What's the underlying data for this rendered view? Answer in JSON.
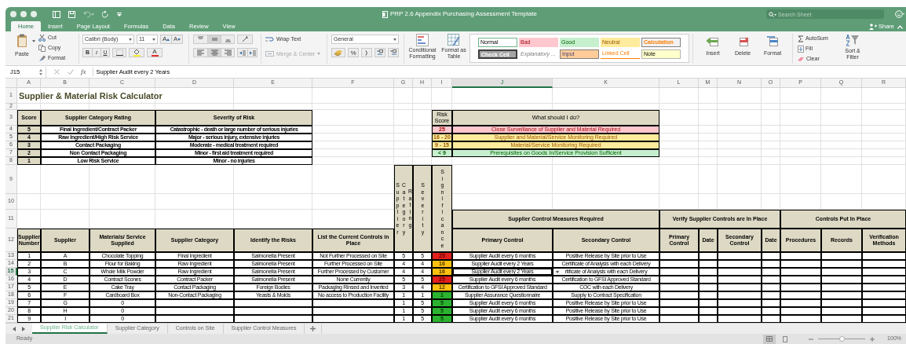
{
  "window": {
    "title": "PRP 2.6 Appendix Purchasing Assessment Template",
    "search_placeholder": "Search Sheet"
  },
  "ribbon_tabs": [
    {
      "label": "Home",
      "selected": true
    },
    {
      "label": "Insert",
      "selected": false
    },
    {
      "label": "Page Layout",
      "selected": false
    },
    {
      "label": "Formulas",
      "selected": false
    },
    {
      "label": "Data",
      "selected": false
    },
    {
      "label": "Review",
      "selected": false
    },
    {
      "label": "View",
      "selected": false
    }
  ],
  "share": "Share",
  "ribbon": {
    "paste": "Paste",
    "cut": "Cut",
    "copy": "Copy",
    "format_painter": "Format",
    "font": "Calibri (Body)",
    "size": "11",
    "grow": "A",
    "shrink": "A",
    "bold": "B",
    "italic": "I",
    "underline": "U",
    "font_color": "A",
    "vertical_align": [
      {
        "selected": false
      },
      {
        "selected": true
      },
      {
        "selected": false
      }
    ],
    "horizontal_align": [
      {
        "selected": false
      },
      {
        "selected": true
      },
      {
        "selected": false
      }
    ],
    "wrap": "Wrap Text",
    "merge": {
      "label": "Merge & Center",
      "disabled": true
    },
    "number_format": "General",
    "percent": "%",
    "conditional": "Conditional Formatting",
    "format_table": "Format as Table",
    "cell_styles": [
      {
        "label": "Normal",
        "kind": "normal"
      },
      {
        "label": "Bad",
        "kind": "bad"
      },
      {
        "label": "Good",
        "kind": "good"
      },
      {
        "label": "Neutral",
        "kind": "neutral"
      },
      {
        "label": "Calculation",
        "kind": "calculation"
      },
      {
        "label": "Check Cell",
        "kind": "check"
      },
      {
        "label": "Explanatory ...",
        "kind": "explanatory"
      },
      {
        "label": "Input",
        "kind": "input"
      },
      {
        "label": "Linked Cell",
        "kind": "linked"
      },
      {
        "label": "Note",
        "kind": "note"
      }
    ],
    "cells": [
      "Insert",
      "Delete",
      "Format"
    ],
    "autosum": "AutoSum",
    "fill": "Fill",
    "clear": "Clear",
    "sort": "Sort & Filter"
  },
  "formula_bar": {
    "cell": "J15",
    "function_label": "fx",
    "value": "Supplier Audit every 2 Years"
  },
  "columns": [
    {
      "label": "A",
      "selected": false
    },
    {
      "label": "B",
      "selected": false
    },
    {
      "label": "C",
      "selected": false
    },
    {
      "label": "D",
      "selected": false
    },
    {
      "label": "E",
      "selected": false
    },
    {
      "label": "F",
      "selected": false
    },
    {
      "label": "G",
      "selected": false
    },
    {
      "label": "H",
      "selected": false
    },
    {
      "label": "I",
      "selected": false
    },
    {
      "label": "J",
      "selected": true
    },
    {
      "label": "K",
      "selected": false
    },
    {
      "label": "L",
      "selected": false
    },
    {
      "label": "M",
      "selected": false
    },
    {
      "label": "N",
      "selected": false
    },
    {
      "label": "O",
      "selected": false
    },
    {
      "label": "P",
      "selected": false
    },
    {
      "label": "Q",
      "selected": false
    },
    {
      "label": "R",
      "selected": false
    }
  ],
  "row_numbers": [
    {
      "label": "1",
      "selected": false
    },
    {
      "label": "2",
      "selected": false
    },
    {
      "label": "3",
      "selected": false
    },
    {
      "label": "4",
      "selected": false
    },
    {
      "label": "5",
      "selected": false
    },
    {
      "label": "6",
      "selected": false
    },
    {
      "label": "7",
      "selected": false
    },
    {
      "label": "8",
      "selected": false
    },
    {
      "label": "9",
      "selected": false
    },
    {
      "label": "10",
      "selected": false
    },
    {
      "label": "11",
      "selected": false
    },
    {
      "label": "12",
      "selected": false
    },
    {
      "label": "13",
      "selected": false
    },
    {
      "label": "14",
      "selected": false
    },
    {
      "label": "15",
      "selected": true
    },
    {
      "label": "16",
      "selected": false
    },
    {
      "label": "17",
      "selected": false
    },
    {
      "label": "18",
      "selected": false
    },
    {
      "label": "19",
      "selected": false
    },
    {
      "label": "20",
      "selected": false
    },
    {
      "label": "21",
      "selected": false
    }
  ],
  "title": "Supplier & Material Risk Calculator",
  "score_table": {
    "headers": [
      "Score",
      "Supplier Category Rating",
      "Severity of Risk"
    ],
    "rows": [
      {
        "score": "5",
        "category": "Final Ingredient/Contract Packer",
        "severity": "Catastrophic - death or large number of serious injuries"
      },
      {
        "score": "4",
        "category": "Raw Ingredient/High Risk Service",
        "severity": "Major - serious injury, extensive injuries"
      },
      {
        "score": "3",
        "category": "Contact Packaging",
        "severity": "Moderate - medical treatment required"
      },
      {
        "score": "2",
        "category": "Non Contact Packaging",
        "severity": "Minor - first aid treatment required"
      },
      {
        "score": "1",
        "category": "Low Risk Service",
        "severity": "Minor - no injuries"
      }
    ]
  },
  "risk_key": {
    "headers": [
      "Risk Score",
      "What should I do?"
    ],
    "rows": [
      {
        "score": "25",
        "action": "Close Surveillance of Supplier and Material Required",
        "color": "#ffc7ce"
      },
      {
        "score": "16 - 20",
        "action": "Supplier and Material/Service Monitoring Required",
        "color": "#ffeb9c"
      },
      {
        "score": "9 - 15",
        "action": "Material/Service Monitoring Required",
        "color": "#ffeb9c"
      },
      {
        "score": "< 9",
        "action": "Prerequisites on Goods In/Service Provision Sufficient",
        "color": "#c6efce"
      }
    ]
  },
  "vertical_headers": [
    "Supplier Category Rating",
    "Severity",
    "Significance"
  ],
  "group_headers": [
    "Supplier Control Measures Required",
    "Verify Supplier Controls are In Place",
    "Controls Put In Place"
  ],
  "main_headers": [
    "Supplier Number",
    "Supplier",
    "Materials/ Service Supplied",
    "Supplier Category",
    "Identify the Risks",
    "List the Current Controls in Place",
    "Primary Control",
    "Secondary Control",
    "Primary Control",
    "Date",
    "Secondary Control",
    "Date",
    "Procedures",
    "Records",
    "Verification Methods"
  ],
  "suppliers": [
    {
      "number": "1",
      "supplier": "A",
      "material": "Chocolate Topping",
      "category": "Final Ingredient",
      "risks": "Salmonella Present",
      "controls": "Not Further Processed on Site",
      "rating": "5",
      "severity": "5",
      "significance": "25",
      "color": "#e2201c",
      "primary": "Supplier Audit every 6 months",
      "secondary": "Positive Release by Site prior to Use"
    },
    {
      "number": "2",
      "supplier": "B",
      "material": "Flour for Baking",
      "category": "Raw Ingredient",
      "risks": "Salmonella Present",
      "controls": "Further Processed on Site",
      "rating": "4",
      "severity": "4",
      "significance": "16",
      "color": "#fdc10f",
      "primary": "Supplier Audit every 2 Years",
      "secondary": "Certificate of Analysis with each Delivery"
    },
    {
      "number": "3",
      "supplier": "C",
      "material": "Whole Milk Powder",
      "category": "Raw Ingredient",
      "risks": "Salmonella Present",
      "controls": "Further Processed by Customer",
      "rating": "4",
      "severity": "4",
      "significance": "16",
      "color": "#fdc10f",
      "primary": "Supplier Audit every 2 Years",
      "secondary": "rtificate of Analysis with each Delivery"
    },
    {
      "number": "4",
      "supplier": "D",
      "material": "Contract Scones",
      "category": "Contract Packer",
      "risks": "Salmonella Present",
      "controls": "None Currently",
      "rating": "5",
      "severity": "5",
      "significance": "25",
      "color": "#e2201c",
      "primary": "Supplier Audit every 6 months",
      "secondary": "Certification to GFSI Approved Standard"
    },
    {
      "number": "5",
      "supplier": "E",
      "material": "Cake Tray",
      "category": "Contact Packaging",
      "risks": "Foreign Bodies",
      "controls": "Packaging Rinsed and Inverted",
      "rating": "3",
      "severity": "4",
      "significance": "12",
      "color": "#fdc10f",
      "primary": "Certification to GFSI Approved Standard",
      "secondary": "COC with each Delivery"
    },
    {
      "number": "6",
      "supplier": "F",
      "material": "Cardboard Box",
      "category": "Non-Contact Packaging",
      "risks": "Yeasts & Molds",
      "controls": "No access to Production Facility",
      "rating": "1",
      "severity": "1",
      "significance": "1",
      "color": "#2bb230",
      "primary": "Supplier Assurance Questionnaire",
      "secondary": "Supply to Contract Specification"
    },
    {
      "number": "7",
      "supplier": "G",
      "material": "0",
      "rating": "1",
      "severity": "5",
      "significance": "5",
      "color": "#2bb230",
      "primary": "Supplier Audit every 6 months",
      "secondary": "Positive Release by Site prior to Use"
    },
    {
      "number": "8",
      "supplier": "H",
      "material": "0",
      "rating": "1",
      "severity": "5",
      "significance": "5",
      "color": "#2bb230",
      "primary": "Supplier Audit every 6 months",
      "secondary": "Positive Release by Site prior to Use"
    },
    {
      "number": "9",
      "supplier": "I",
      "material": "0",
      "rating": "1",
      "severity": "5",
      "significance": "5",
      "color": "#2bb230",
      "primary": "Supplier Audit every 6 months",
      "secondary": "Positive Release by Site prior to Use"
    }
  ],
  "sheet_tabs": [
    {
      "label": "Supplier Risk Calculator",
      "selected": true
    },
    {
      "label": "Supplier Category",
      "selected": false
    },
    {
      "label": "Controls on Site",
      "selected": false
    },
    {
      "label": "Supplier Control Measures",
      "selected": false
    }
  ],
  "status": "Ready",
  "zoom": {
    "level": 0.5,
    "reading": "100%"
  }
}
